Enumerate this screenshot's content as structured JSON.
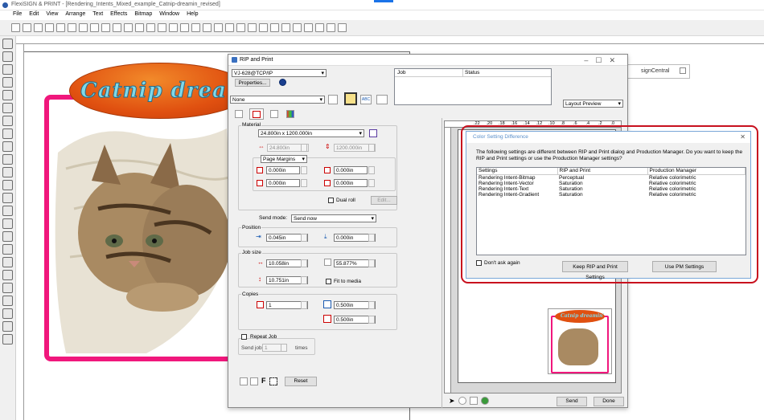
{
  "app": {
    "title": "FlexiSIGN & PRINT - [Rendering_Intents_Mixed_example_Catnip-dreamin_revised]"
  },
  "menu": [
    "File",
    "Edit",
    "View",
    "Arrange",
    "Text",
    "Effects",
    "Bitmap",
    "Window",
    "Help"
  ],
  "artwork": {
    "oval_text": "Catnip drea",
    "frame_color": "#f0177c",
    "oval_color": "#e05010"
  },
  "background_window": {
    "title": "signCentral"
  },
  "rip": {
    "title": "RIP and Print",
    "printer": "VJ-628@TCP/IP",
    "properties_label": "Properties...",
    "setup": "None",
    "job_table": {
      "headers": [
        "Job",
        "Status"
      ]
    },
    "preview_mode": "Layout Preview",
    "material": {
      "label": "Material",
      "size": "24.800in x 1200.000in",
      "width": "24.800in",
      "height": "1200.000in",
      "margins_label": "Page Margins",
      "margin_left": "0.000in",
      "margin_right": "0.000in",
      "margin_top": "0.000in",
      "margin_bottom": "0.000in",
      "dual_roll_label": "Dual roll",
      "edit_label": "Edit..."
    },
    "send_mode_label": "Send mode:",
    "send_mode": "Send now",
    "position": {
      "label": "Position",
      "x": "0.045in",
      "y": "0.000in"
    },
    "job_size": {
      "label": "Job size",
      "width": "10.058in",
      "height": "10.751in",
      "scale": "55.877%",
      "fit_label": "Fit to media"
    },
    "copies": {
      "label": "Copies",
      "count": "1",
      "h_spacing": "0.500in",
      "v_spacing": "0.500in"
    },
    "repeat": {
      "label": "Repeat Job",
      "send_job_label": "Send job",
      "send_job_value": "1",
      "times_label": "times"
    },
    "reset_label": "Reset",
    "send_label": "Send",
    "done_label": "Done",
    "ruler_numbers": [
      ".22",
      ".20",
      ".18",
      ".16",
      ".14",
      ".12",
      ".10",
      ".8",
      ".6",
      ".4",
      ".2",
      ".0"
    ]
  },
  "dialog": {
    "title": "Color Setting Difference",
    "message": "The following settings are different between RIP and Print dialog and Production Manager. Do you want to keep the RIP and Print settings or use the Production Manager settings?",
    "columns": [
      "Settings",
      "RIP and Print",
      "Production Manager"
    ],
    "rows": [
      [
        "Rendering Intent-Bitmap",
        "Perceptual",
        "Relative colorimetric"
      ],
      [
        "Rendering Intent-Vector",
        "Saturation",
        "Relative colorimetric"
      ],
      [
        "Rendering Intent-Text",
        "Saturation",
        "Relative colorimetric"
      ],
      [
        "Rendering Intent-Gradient",
        "Saturation",
        "Relative colorimetric"
      ]
    ],
    "dont_ask_label": "Don't ask again",
    "keep_label": "Keep RIP and Print Settings",
    "use_pm_label": "Use PM Settings"
  }
}
